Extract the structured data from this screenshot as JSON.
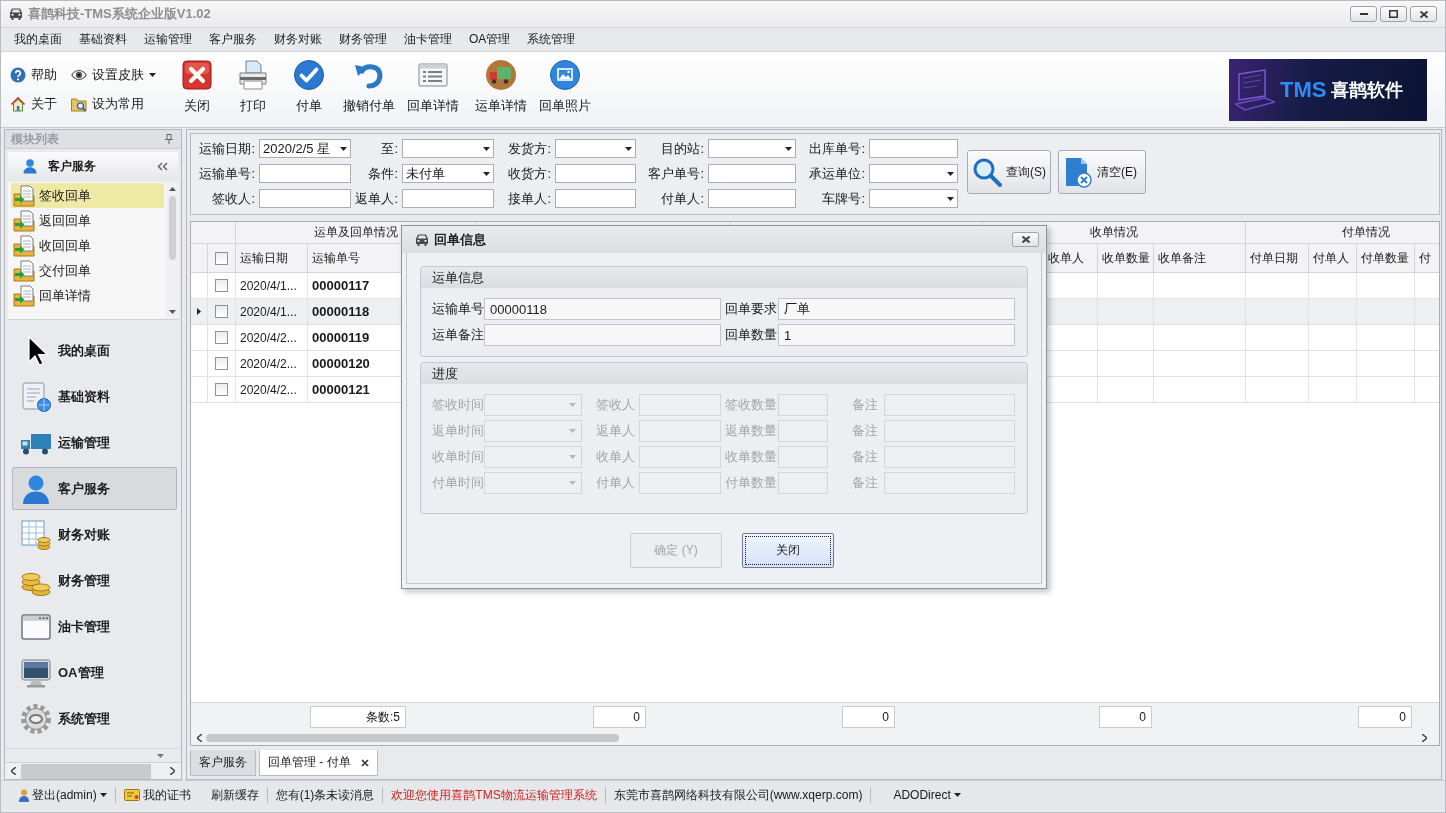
{
  "window": {
    "title": "喜鹊科技-TMS系统企业版V1.02"
  },
  "menu": [
    "我的桌面",
    "基础资料",
    "运输管理",
    "客户服务",
    "财务对账",
    "财务管理",
    "油卡管理",
    "OA管理",
    "系统管理"
  ],
  "toolbar": {
    "small": [
      {
        "label": "帮助",
        "dropdown": false
      },
      {
        "label": "设置皮肤",
        "dropdown": true
      },
      {
        "label": "关于",
        "dropdown": false
      },
      {
        "label": "设为常用",
        "dropdown": false
      }
    ],
    "large": [
      {
        "label": "关闭"
      },
      {
        "label": "打印"
      },
      {
        "label": "付单"
      },
      {
        "label": "撤销付单"
      },
      {
        "label": "回单详情"
      },
      {
        "label": "运单详情"
      },
      {
        "label": "回单照片"
      }
    ]
  },
  "logo": {
    "mark": "TMS",
    "name": "喜鹊软件"
  },
  "sidebar": {
    "title": "模块列表",
    "group": "客户服务",
    "items": [
      {
        "label": "签收回单",
        "selected": true
      },
      {
        "label": "返回回单",
        "selected": false
      },
      {
        "label": "收回回单",
        "selected": false
      },
      {
        "label": "交付回单",
        "selected": false
      },
      {
        "label": "回单详情",
        "selected": false
      }
    ],
    "modules": [
      {
        "label": "我的桌面",
        "selected": false
      },
      {
        "label": "基础资料",
        "selected": false
      },
      {
        "label": "运输管理",
        "selected": false
      },
      {
        "label": "客户服务",
        "selected": true
      },
      {
        "label": "财务对账",
        "selected": false
      },
      {
        "label": "财务管理",
        "selected": false
      },
      {
        "label": "油卡管理",
        "selected": false
      },
      {
        "label": "OA管理",
        "selected": false
      },
      {
        "label": "系统管理",
        "selected": false
      }
    ]
  },
  "filters": {
    "fields": [
      {
        "label": "运输日期:",
        "kind": "combo",
        "value": "2020/2/5 星"
      },
      {
        "label": "至:",
        "kind": "combo"
      },
      {
        "label": "发货方:",
        "kind": "combo"
      },
      {
        "label": "目的站:",
        "kind": "combo"
      },
      {
        "label": "出库单号:",
        "kind": "text"
      },
      {
        "label": "运输单号:",
        "kind": "text"
      },
      {
        "label": "条件:",
        "kind": "combo",
        "value": "未付单"
      },
      {
        "label": "收货方:",
        "kind": "text"
      },
      {
        "label": "客户单号:",
        "kind": "text"
      },
      {
        "label": "承运单位:",
        "kind": "combo"
      },
      {
        "label": "签收人:",
        "kind": "text"
      },
      {
        "label": "返单人:",
        "kind": "text"
      },
      {
        "label": "接单人:",
        "kind": "text"
      },
      {
        "label": "付单人:",
        "kind": "text"
      },
      {
        "label": "车牌号:",
        "kind": "combo"
      }
    ],
    "buttons": [
      {
        "label": "查询(S)"
      },
      {
        "label": "清空(E)"
      }
    ]
  },
  "table": {
    "groups": [
      "运单及回单情况",
      "收单情况",
      "付单情况"
    ],
    "select_all_checked": false,
    "columns": [
      "运输日期",
      "运输单号",
      "收单人",
      "收单数量",
      "收单备注",
      "付单日期",
      "付单人",
      "付单数量",
      "付"
    ],
    "rows": [
      {
        "date": "2020/4/1...",
        "number": "00000117",
        "checked": false,
        "selected": false
      },
      {
        "date": "2020/4/1...",
        "number": "00000118",
        "checked": false,
        "selected": true
      },
      {
        "date": "2020/4/2...",
        "number": "00000119",
        "checked": false,
        "selected": false
      },
      {
        "date": "2020/4/2...",
        "number": "00000120",
        "checked": false,
        "selected": false
      },
      {
        "date": "2020/4/2...",
        "number": "00000121",
        "checked": false,
        "selected": false
      }
    ],
    "totals": [
      "条数:5",
      "0",
      "0",
      "0",
      "0"
    ]
  },
  "tabs": [
    {
      "label": "客户服务",
      "selected": false,
      "closable": false
    },
    {
      "label": "回单管理 - 付单",
      "selected": true,
      "closable": true
    }
  ],
  "status_bar": {
    "user": "登出(admin)",
    "certificate": "我的证书",
    "refresh": "刷新缓存",
    "messages": "您有(1)条未读消息",
    "welcome": "欢迎您使用喜鹊TMS物流运输管理系统",
    "company": "东莞市喜鹊网络科技有限公司(www.xqerp.com)",
    "connection": "ADODirect"
  },
  "dialog": {
    "title": "回单信息",
    "waybill": {
      "title": "运单信息",
      "fields": [
        {
          "label": "运输单号",
          "value": "00000118"
        },
        {
          "label": "回单要求",
          "value": "厂单"
        },
        {
          "label": "运单备注"
        },
        {
          "label": "回单数量",
          "value": "1"
        }
      ]
    },
    "progress": {
      "title": "进度",
      "rows": [
        [
          {
            "label": "签收时间",
            "kind": "combo",
            "disabled": true
          },
          {
            "label": "签收人",
            "kind": "text",
            "disabled": true
          },
          {
            "label": "签收数量",
            "kind": "text",
            "disabled": true
          },
          {
            "label": "备注",
            "kind": "text",
            "disabled": true
          }
        ],
        [
          {
            "label": "返单时间",
            "kind": "combo",
            "disabled": true
          },
          {
            "label": "返单人",
            "kind": "text",
            "disabled": true
          },
          {
            "label": "返单数量",
            "kind": "text",
            "disabled": true
          },
          {
            "label": "备注",
            "kind": "text",
            "disabled": true
          }
        ],
        [
          {
            "label": "收单时间",
            "kind": "combo",
            "disabled": true
          },
          {
            "label": "收单人",
            "kind": "text",
            "disabled": true
          },
          {
            "label": "收单数量",
            "kind": "text",
            "disabled": true
          },
          {
            "label": "备注",
            "kind": "text",
            "disabled": true
          }
        ],
        [
          {
            "label": "付单时间",
            "kind": "combo",
            "disabled": true
          },
          {
            "label": "付单人",
            "kind": "text",
            "disabled": true
          },
          {
            "label": "付单数量",
            "kind": "text",
            "disabled": true
          },
          {
            "label": "备注",
            "kind": "text",
            "disabled": true
          }
        ]
      ]
    },
    "buttons": [
      {
        "label": "确定 (Y)",
        "disabled": true,
        "focused": false
      },
      {
        "label": "关闭",
        "disabled": false,
        "focused": true
      }
    ]
  }
}
